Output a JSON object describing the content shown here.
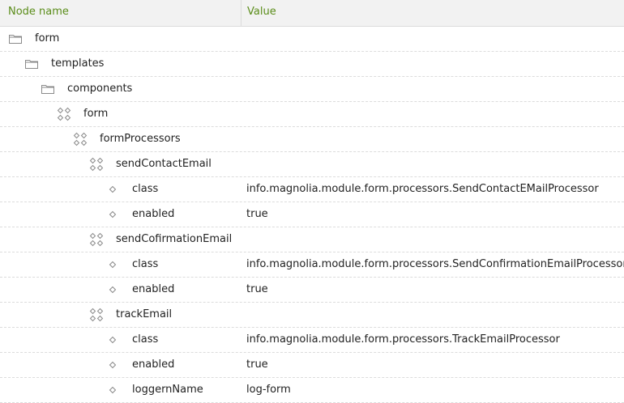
{
  "columns": {
    "name": "Node name",
    "value": "Value"
  },
  "rows": [
    {
      "name": "form",
      "value": "",
      "icon": "folder-icon"
    },
    {
      "name": "templates",
      "value": "",
      "icon": "folder-icon"
    },
    {
      "name": "components",
      "value": "",
      "icon": "folder-icon"
    },
    {
      "name": "form",
      "value": "",
      "icon": "node-icon"
    },
    {
      "name": "formProcessors",
      "value": "",
      "icon": "node-icon"
    },
    {
      "name": "sendContactEmail",
      "value": "",
      "icon": "node-icon"
    },
    {
      "name": "class",
      "value": "info.magnolia.module.form.processors.SendContactEMailProcessor",
      "icon": "property-icon"
    },
    {
      "name": "enabled",
      "value": "true",
      "icon": "property-icon"
    },
    {
      "name": "sendCofirmationEmail",
      "value": "",
      "icon": "node-icon"
    },
    {
      "name": "class",
      "value": "info.magnolia.module.form.processors.SendConfirmationEmailProcessor",
      "icon": "property-icon"
    },
    {
      "name": "enabled",
      "value": "true",
      "icon": "property-icon"
    },
    {
      "name": "trackEmail",
      "value": "",
      "icon": "node-icon"
    },
    {
      "name": "class",
      "value": "info.magnolia.module.form.processors.TrackEmailProcessor",
      "icon": "property-icon"
    },
    {
      "name": "enabled",
      "value": "true",
      "icon": "property-icon"
    },
    {
      "name": "loggernName",
      "value": "log-form",
      "icon": "property-icon"
    }
  ]
}
